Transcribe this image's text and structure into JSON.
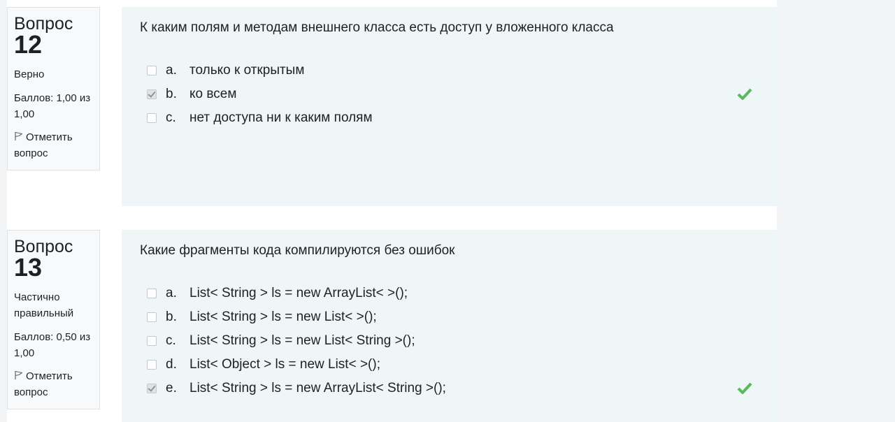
{
  "colors": {
    "info_bg": "#f8f9fa",
    "content_bg": "#eef6f8",
    "correct_tick": "#5cb85c"
  },
  "questions": [
    {
      "word": "Вопрос",
      "number": "12",
      "state": "Верно",
      "grade": "Баллов: 1,00 из 1,00",
      "flag_label": "Отметить вопрос",
      "text": "К каким полям и методам внешнего класса есть доступ у вложенного класса",
      "answers": [
        {
          "letter": "a.",
          "text": "только к открытым",
          "checked": false,
          "correct_mark": false
        },
        {
          "letter": "b.",
          "text": "ко всем",
          "checked": true,
          "correct_mark": true
        },
        {
          "letter": "c.",
          "text": "нет доступа ни к каким полям",
          "checked": false,
          "correct_mark": false
        }
      ]
    },
    {
      "word": "Вопрос",
      "number": "13",
      "state": "Частично правильный",
      "grade": "Баллов: 0,50 из 1,00",
      "flag_label": "Отметить вопрос",
      "text": "Какие фрагменты кода компилируются без ошибок",
      "answers": [
        {
          "letter": "a.",
          "text": "List< String > ls = new ArrayList< >();",
          "checked": false,
          "correct_mark": false
        },
        {
          "letter": "b.",
          "text": "List< String > ls = new List< >();",
          "checked": false,
          "correct_mark": false
        },
        {
          "letter": "c.",
          "text": "List< String > ls = new List< String >();",
          "checked": false,
          "correct_mark": false
        },
        {
          "letter": "d.",
          "text": "List< Object > ls = new List< >();",
          "checked": false,
          "correct_mark": false
        },
        {
          "letter": "e.",
          "text": "List< String > ls = new ArrayList< String >();",
          "checked": true,
          "correct_mark": true
        }
      ]
    }
  ]
}
